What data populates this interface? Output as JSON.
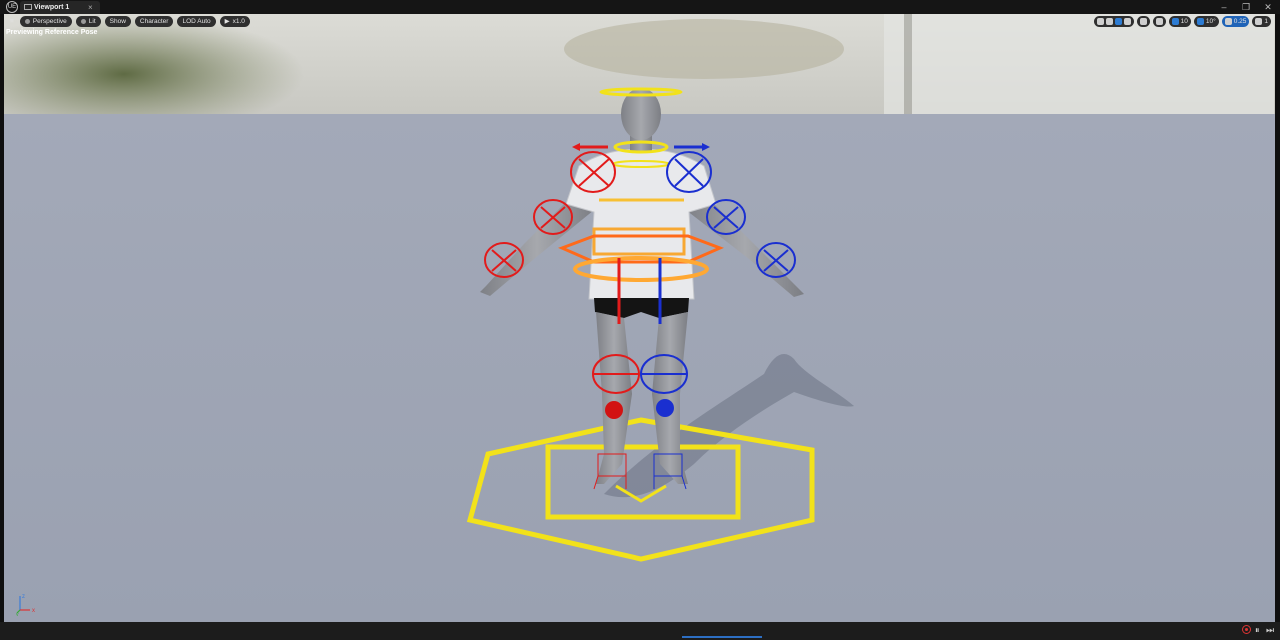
{
  "titlebar": {
    "app_logo": "UE",
    "tab_label": "Viewport 1",
    "tab_close": "×",
    "minimize": "–",
    "restore": "❐",
    "close": "✕"
  },
  "toolbar": {
    "menu_icon": "≡",
    "perspective": "Perspective",
    "lit": "Lit",
    "show": "Show",
    "character": "Character",
    "lod": "LOD Auto",
    "speed": "x1.0"
  },
  "status": "Previewing Reference Pose",
  "right_toolbar": {
    "grid_snap": "10",
    "rotate_snap": "10°",
    "scale_snap": "0.25",
    "camera_speed": "1"
  },
  "axis": {
    "z": "z",
    "x": "x",
    "y": "y"
  },
  "colors": {
    "control_yellow": "#f2e21a",
    "left_red": "#e21b1b",
    "right_blue": "#1a2fd0",
    "orange": "#ff7a1a",
    "floor": "#9fa6b6",
    "body": "#8f9196"
  },
  "playback": {
    "record": "record-icon",
    "pause": "⏸",
    "step": "⏭"
  }
}
